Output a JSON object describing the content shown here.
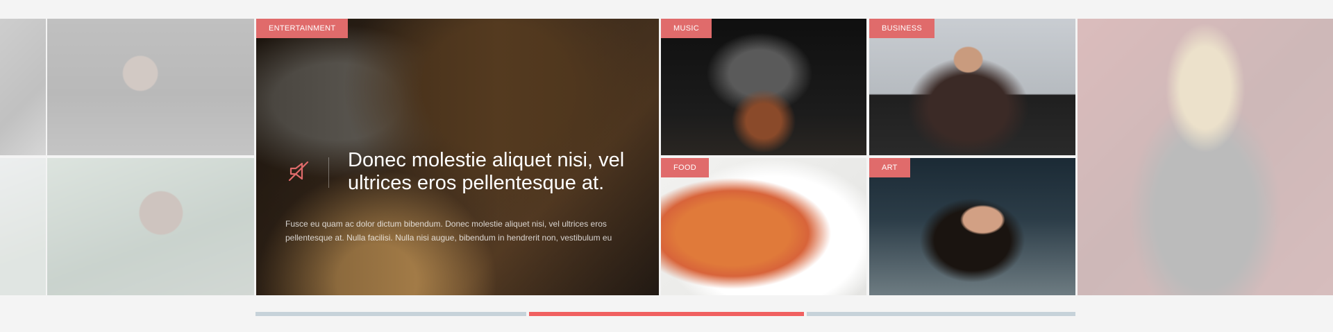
{
  "featured": {
    "category": "ENTERTAINMENT",
    "headline": "Donec molestie aliquet nisi, vel ultrices eros pellentesque at.",
    "excerpt": "Fusce eu quam ac dolor dictum bibendum. Donec molestie aliquet nisi, vel ultrices eros pellentesque at. Nulla facilisi. Nulla nisi augue, bibendum in hendrerit non, vestibulum eu",
    "icon": "broken-speaker-icon"
  },
  "tiles": [
    {
      "category": "MUSIC",
      "image": "guitarist-photo"
    },
    {
      "category": "BUSINESS",
      "image": "businessman-photo"
    },
    {
      "category": "FOOD",
      "image": "pasta-photo"
    },
    {
      "category": "ART",
      "image": "woman-splash-photo"
    }
  ],
  "progress": {
    "segments": 3,
    "active_index": 1,
    "colors": {
      "active": "#f06060",
      "inactive": "#c6d2d9",
      "tag": "#e06b6b"
    }
  }
}
